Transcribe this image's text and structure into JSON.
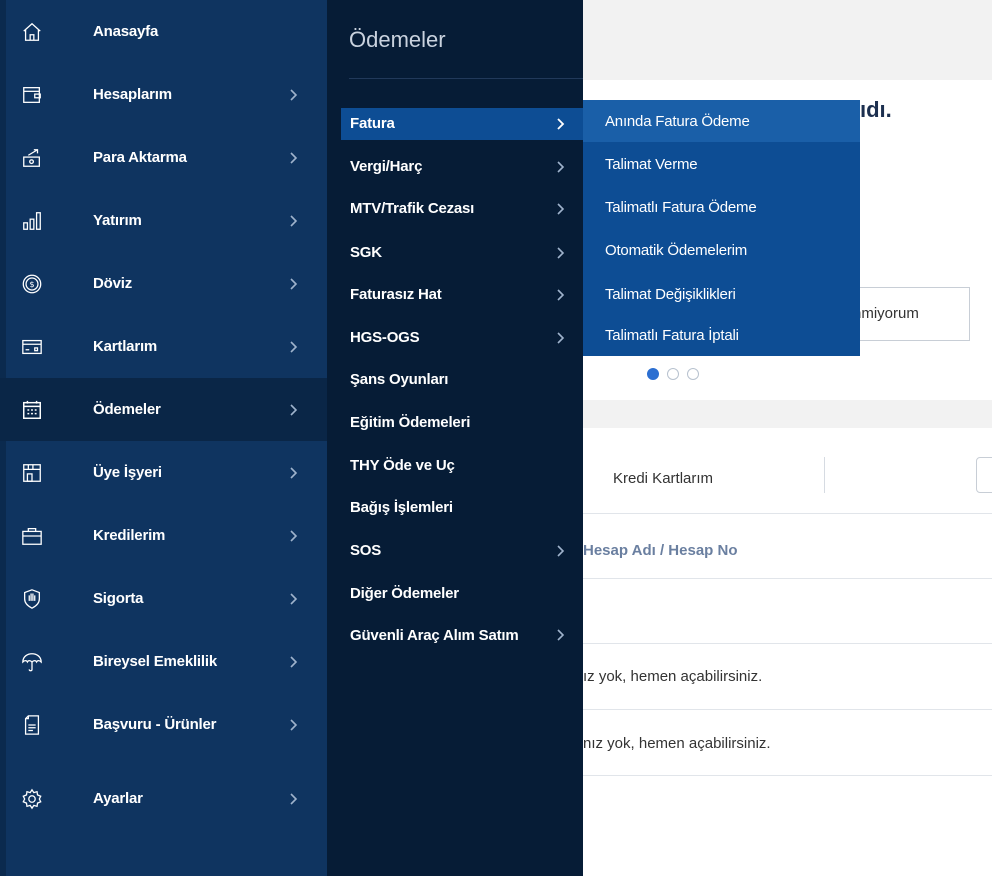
{
  "sidebar": {
    "items": [
      {
        "label": "Anasayfa",
        "icon": "home-icon",
        "chevron": false
      },
      {
        "label": "Hesaplarım",
        "icon": "wallet-icon",
        "chevron": true
      },
      {
        "label": "Para Aktarma",
        "icon": "transfer-icon",
        "chevron": true
      },
      {
        "label": "Yatırım",
        "icon": "bar-chart-icon",
        "chevron": true
      },
      {
        "label": "Döviz",
        "icon": "dollar-coin-icon",
        "chevron": true
      },
      {
        "label": "Kartlarım",
        "icon": "card-icon",
        "chevron": true
      },
      {
        "label": "Ödemeler",
        "icon": "calendar-icon",
        "chevron": true,
        "active": true
      },
      {
        "label": "Üye İşyeri",
        "icon": "store-icon",
        "chevron": true
      },
      {
        "label": "Kredilerim",
        "icon": "briefcase-icon",
        "chevron": true
      },
      {
        "label": "Sigorta",
        "icon": "shield-hand-icon",
        "chevron": true
      },
      {
        "label": "Bireysel Emeklilik",
        "icon": "umbrella-icon",
        "chevron": true
      },
      {
        "label": "Başvuru - Ürünler",
        "icon": "document-icon",
        "chevron": true
      },
      {
        "label": "Ayarlar",
        "icon": "gear-icon",
        "chevron": true
      }
    ]
  },
  "submenu": {
    "title": "Ödemeler",
    "items": [
      {
        "label": "Fatura",
        "chevron": true,
        "active": true
      },
      {
        "label": "Vergi/Harç",
        "chevron": true
      },
      {
        "label": "MTV/Trafik Cezası",
        "chevron": true
      },
      {
        "label": "SGK",
        "chevron": true
      },
      {
        "label": "Faturasız Hat",
        "chevron": true
      },
      {
        "label": "HGS-OGS",
        "chevron": true
      },
      {
        "label": "Şans Oyunları",
        "chevron": false
      },
      {
        "label": "Eğitim Ödemeleri",
        "chevron": false
      },
      {
        "label": "THY Öde ve Uç",
        "chevron": false
      },
      {
        "label": "Bağış İşlemleri",
        "chevron": false
      },
      {
        "label": "SOS",
        "chevron": true
      },
      {
        "label": "Diğer Ödemeler",
        "chevron": false
      },
      {
        "label": "Güvenli Araç Alım Satım",
        "chevron": true
      }
    ]
  },
  "flyout": {
    "items": [
      {
        "label": "Anında Fatura Ödeme"
      },
      {
        "label": "Talimat Verme"
      },
      {
        "label": "Talimatlı Fatura Ödeme"
      },
      {
        "label": "Otomatik Ödemelerim"
      },
      {
        "label": "Talimat Değişiklikleri"
      },
      {
        "label": "Talimatlı Fatura İptali"
      }
    ]
  },
  "background": {
    "greeting_fragment": "ıdı.",
    "outline_button_fragment": "nmiyorum",
    "tab_label": "Kredi Kartlarım",
    "column_header_fragment": "Hesap Adı / Hesap No",
    "row1_fragment": "ız yok, hemen açabilirsiniz.",
    "row2_fragment": "nız yok, hemen açabilirsiniz."
  },
  "carousel": {
    "count": 3,
    "active": 1
  },
  "colors": {
    "sidebar": "#0f3460",
    "submenu": "#061c36",
    "flyout": "#0d4d94",
    "active_accent": "#2c6fd1"
  }
}
